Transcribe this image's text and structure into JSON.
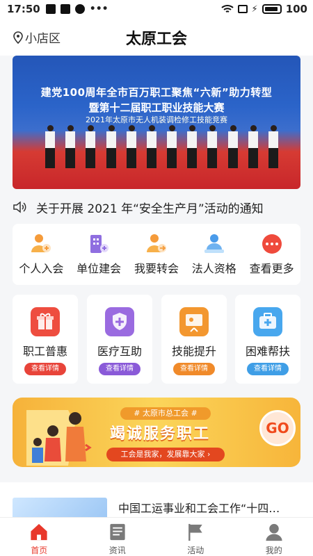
{
  "status_bar": {
    "time": "17:50",
    "battery": "100"
  },
  "header": {
    "location": "小店区",
    "title": "太原工会"
  },
  "banner": {
    "line1": "建党100周年全市百万职工聚焦“六新”助力转型",
    "line2": "暨第十二届职工职业技能大赛",
    "line3": "2021年太原市无人机装调检修工技能竞赛"
  },
  "notice": {
    "text": "关于开展 2021 年“安全生产月”活动的通知"
  },
  "quick_actions": [
    {
      "label": "个人入会",
      "icon": "person-add-icon"
    },
    {
      "label": "单位建会",
      "icon": "building-add-icon"
    },
    {
      "label": "我要转会",
      "icon": "person-transfer-icon"
    },
    {
      "label": "法人资格",
      "icon": "legal-person-icon"
    },
    {
      "label": "查看更多",
      "icon": "more-dots-icon"
    }
  ],
  "services": [
    {
      "label": "职工普惠",
      "button": "查看详情",
      "color": "#e8443a",
      "icon": "gift-icon"
    },
    {
      "label": "医疗互助",
      "button": "查看详情",
      "color": "#8a5ad8",
      "icon": "medical-shield-icon"
    },
    {
      "label": "技能提升",
      "button": "查看详情",
      "color": "#f08a2a",
      "icon": "training-board-icon"
    },
    {
      "label": "困难帮扶",
      "button": "查看详情",
      "color": "#3f9ee6",
      "icon": "first-aid-kit-icon"
    }
  ],
  "promo": {
    "sub": "# 太原市总工会 #",
    "main": "竭诚服务职工",
    "tagline": "工会是我家，发展靠大家",
    "go": "GO"
  },
  "news": {
    "title": "中国工运事业和工会工作“十四…"
  },
  "tabs": [
    {
      "label": "首页",
      "icon": "home-icon"
    },
    {
      "label": "资讯",
      "icon": "news-icon"
    },
    {
      "label": "活动",
      "icon": "flag-icon"
    },
    {
      "label": "我的",
      "icon": "user-icon"
    }
  ],
  "colors": {
    "accent": "#e8382b"
  }
}
